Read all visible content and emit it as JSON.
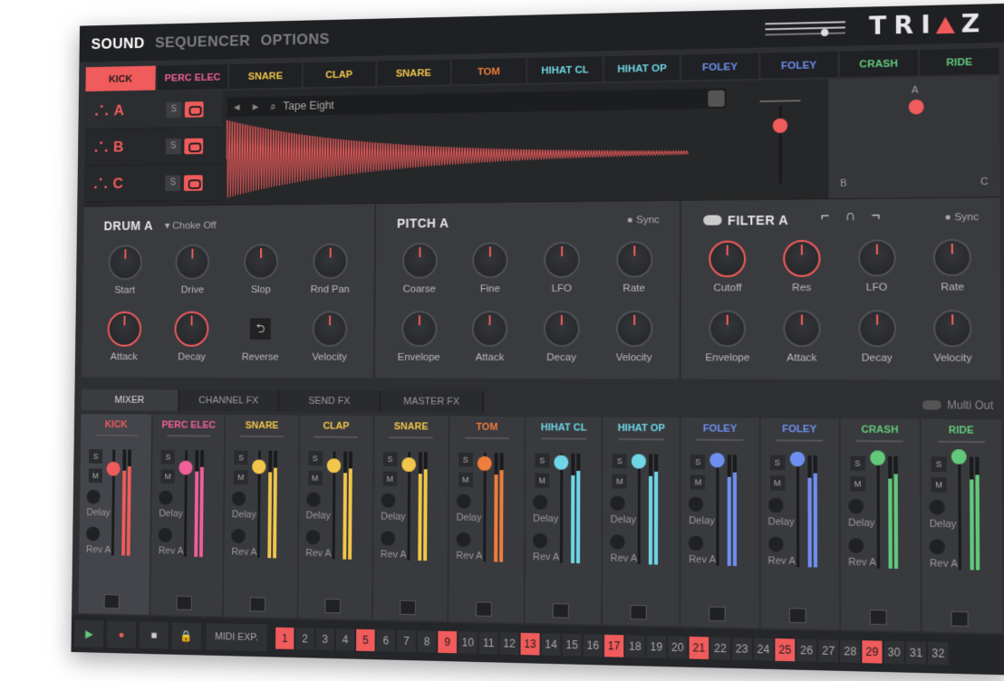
{
  "nav": {
    "items": [
      "SOUND",
      "SEQUENCER",
      "OPTIONS"
    ],
    "active": "SOUND"
  },
  "logo": {
    "left": "TRI",
    "right": "Z"
  },
  "drums": [
    {
      "label": "KICK",
      "color": "#f05b5b",
      "active": true
    },
    {
      "label": "PERC ELEC",
      "color": "#f0609a"
    },
    {
      "label": "SNARE",
      "color": "#f2c64a"
    },
    {
      "label": "CLAP",
      "color": "#f2c64a"
    },
    {
      "label": "SNARE",
      "color": "#f2c64a"
    },
    {
      "label": "TOM",
      "color": "#ef7d3c"
    },
    {
      "label": "HIHAT CL",
      "color": "#6fd6e6"
    },
    {
      "label": "HIHAT OP",
      "color": "#6fd6e6"
    },
    {
      "label": "FOLEY",
      "color": "#6f8ff0"
    },
    {
      "label": "FOLEY",
      "color": "#6f8ff0"
    },
    {
      "label": "CRASH",
      "color": "#62c97a"
    },
    {
      "label": "RIDE",
      "color": "#62c97a"
    }
  ],
  "layers": [
    {
      "label": "A",
      "s": "S"
    },
    {
      "label": "B",
      "s": "S"
    },
    {
      "label": "C",
      "s": "S"
    }
  ],
  "sample": {
    "name": "Tape Eight"
  },
  "pad": {
    "a": "A",
    "b": "B",
    "c": "C"
  },
  "drum_section": {
    "title": "DRUM A",
    "choke": "Choke Off",
    "knobs": [
      "Start",
      "Drive",
      "Slop",
      "Rnd Pan",
      "Attack",
      "Decay",
      "Reverse",
      "Velocity"
    ]
  },
  "pitch_section": {
    "title": "PITCH A",
    "sync": "Sync",
    "knobs": [
      "Coarse",
      "Fine",
      "LFO",
      "Rate",
      "Envelope",
      "Attack",
      "Decay",
      "Velocity"
    ]
  },
  "filter_section": {
    "title": "FILTER A",
    "sync": "Sync",
    "knobs": [
      "Cutoff",
      "Res",
      "LFO",
      "Rate",
      "Envelope",
      "Attack",
      "Decay",
      "Velocity"
    ]
  },
  "mixer": {
    "tabs": [
      "MIXER",
      "CHANNEL FX",
      "SEND FX",
      "MASTER FX"
    ],
    "active": "MIXER",
    "multi_out": "Multi Out",
    "delay": "Delay",
    "rev": "Rev A",
    "s": "S",
    "m": "M"
  },
  "transport": {
    "midi": "MIDI EXP."
  },
  "steps": {
    "count": 32,
    "on": [
      1,
      5,
      9,
      13,
      17,
      21,
      25,
      29
    ]
  }
}
